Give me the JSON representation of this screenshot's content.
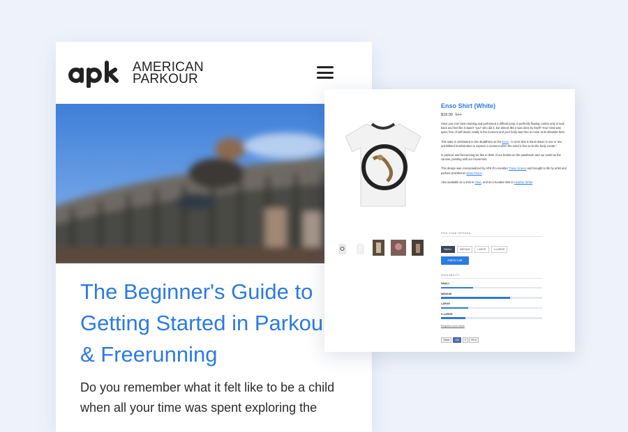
{
  "mobile": {
    "logo": {
      "mark": "apk",
      "line1": "AMERICAN",
      "line2": "PARKOUR"
    },
    "menu_icon": "hamburger-menu-icon",
    "hero_icon": "hero-photo",
    "article_title": "The Beginner's Guide to\nGetting Started in Parkour\n& Freerunning",
    "article_intro": "Do you remember what it felt like to be a child when all your time was spent exploring the"
  },
  "product": {
    "title": "Enso Shirt (White)",
    "price": "$18.00",
    "old_price": "$24",
    "desc": [
      "Have you ever been training and performed a difficult jump or perfectly flowing combo only to look back and feel like it wasn't \"you\" who did it, but almost like it was done by itself? Your mind was quiet, free of self-doubt, totally in the moment and your body was free to move at its absolute best.",
      "This state is celebrated in Zen Buddhism as the ",
      "Ensō",
      ", \"A circle that is hand-drawn in one or two uninhibited brushstrokes to express a moment when the mind is free to let the body create.\"",
      "In parkour and freerunning we like to think of our bodies as the paintbrush and our world as the canvas, painting with our movement.",
      "This design was conceptualized by APK Pro member ",
      "Travis Graves",
      " and brought to life by artist and parkour practitioner ",
      "Brian Prince",
      ".",
      "Also available as a shirt in ",
      "Olive",
      ", and as a hooded shirt in ",
      "Heather White",
      "."
    ],
    "options_label": "PICK YOUR OPTIONS",
    "sizes": [
      "SMALL",
      "MEDIUM",
      "LARGE",
      "X-LARGE"
    ],
    "selected_size": "SMALL",
    "add_to_cart": "Add to Cart",
    "availability_label": "AVAILABILITY",
    "availability": [
      {
        "name": "SMALL",
        "level": 0.32
      },
      {
        "name": "MEDIUM",
        "level": 0.68
      },
      {
        "name": "LARGE",
        "level": 0.27
      },
      {
        "name": "X-LARGE",
        "level": 0.24
      }
    ],
    "request_link": "Request more stock",
    "social": [
      "Tweet",
      "Like",
      "0",
      "Pin it"
    ],
    "colors": {
      "accent": "#2b7be0",
      "dark_button": "#3d4656"
    }
  }
}
